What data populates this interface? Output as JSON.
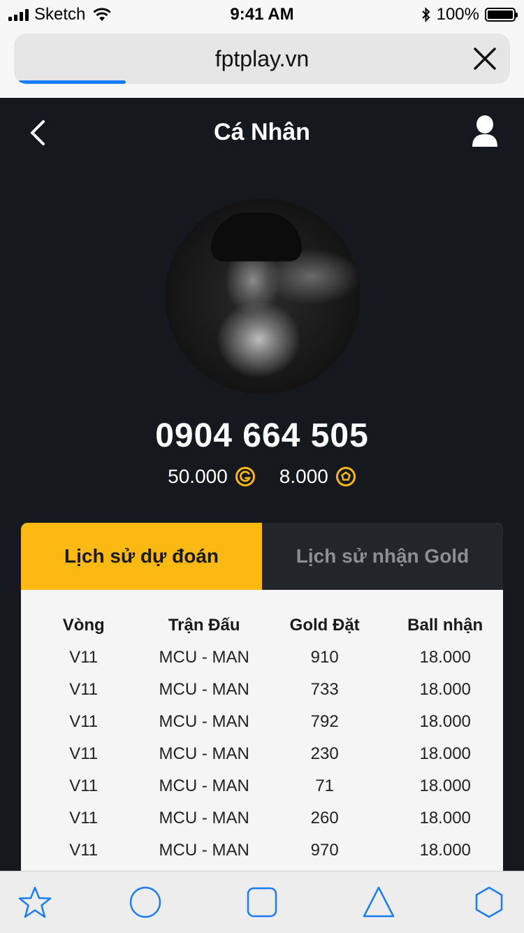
{
  "status_bar": {
    "carrier": "Sketch",
    "time": "9:41 AM",
    "battery": "100%"
  },
  "browser": {
    "url": "fptplay.vn",
    "load_progress": 0.2
  },
  "header": {
    "title": "Cá Nhân"
  },
  "profile": {
    "phone": "0904 664 505",
    "gold": "50.000",
    "balls": "8.000"
  },
  "tabs": [
    {
      "label": "Lịch sử dự đoán",
      "active": true
    },
    {
      "label": "Lịch sử nhận Gold",
      "active": false
    }
  ],
  "table": {
    "headers": [
      "Vòng",
      "Trận Đấu",
      "Gold Đặt",
      "Ball nhận"
    ],
    "rows": [
      [
        "V11",
        "MCU - MAN",
        "910",
        "18.000"
      ],
      [
        "V11",
        "MCU - MAN",
        "733",
        "18.000"
      ],
      [
        "V11",
        "MCU - MAN",
        "792",
        "18.000"
      ],
      [
        "V11",
        "MCU - MAN",
        "230",
        "18.000"
      ],
      [
        "V11",
        "MCU - MAN",
        "71",
        "18.000"
      ],
      [
        "V11",
        "MCU - MAN",
        "260",
        "18.000"
      ],
      [
        "V11",
        "MCU - MAN",
        "970",
        "18.000"
      ]
    ]
  },
  "bottom_bar": {
    "icons": [
      "star-icon",
      "circle-icon",
      "square-icon",
      "triangle-icon",
      "hexagon-icon"
    ]
  },
  "colors": {
    "accent": "#fcb813",
    "background": "#15181d",
    "link_blue": "#1a7df5"
  }
}
